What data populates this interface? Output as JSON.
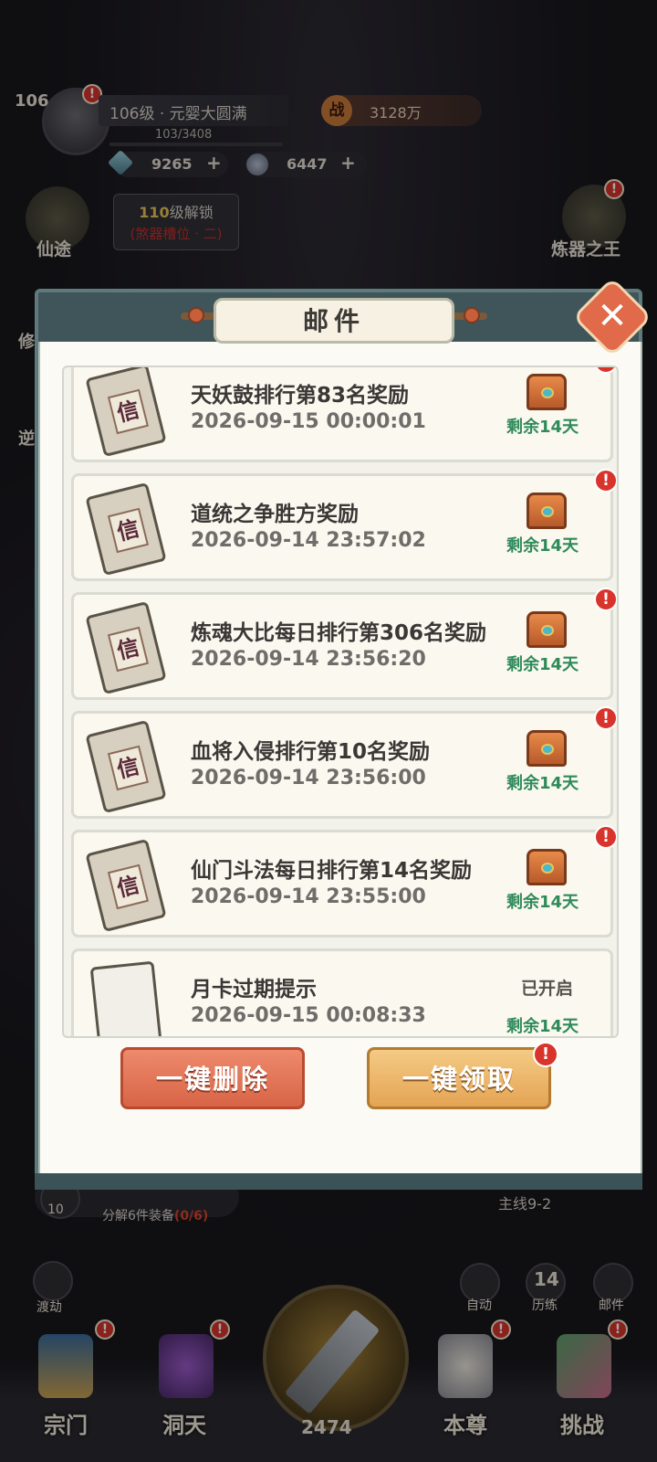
{
  "hud": {
    "player_level": "106",
    "player_title": "106级 · 元婴大圆满",
    "exp": "103/3408",
    "power_badge": "战",
    "power": "3128万",
    "gems": "9265",
    "coins": "6447",
    "plus": "+",
    "xiantu": "仙途",
    "lianqi": "炼器之王",
    "unlock_level": "110",
    "unlock_suffix": "级解锁",
    "unlock_desc": "(煞器槽位 · 二)",
    "left_peek_1": "修",
    "left_peek_2": "逆",
    "decompose_count": "10",
    "decompose_text": "分解6件装备",
    "decompose_progress": "(0/6)",
    "mainline": "主线9-2",
    "dujie": "渡劫",
    "auto": "自动",
    "lilian_count": "14",
    "lilian": "历练",
    "mail": "邮件",
    "orb_count": "2474",
    "nav": [
      "宗门",
      "洞天",
      "本尊",
      "挑战"
    ]
  },
  "modal": {
    "title": "邮件",
    "delete_all": "一键删除",
    "claim_all": "一键领取",
    "alert": "!",
    "stamp": "信"
  },
  "mails": [
    {
      "title": "天妖鼓排行第83名奖励",
      "date": "2026-09-15 00:00:01",
      "status": "",
      "remain": "剩余14天"
    },
    {
      "title": "道统之争胜方奖励",
      "date": "2026-09-14 23:57:02",
      "status": "",
      "remain": "剩余14天"
    },
    {
      "title": "炼魂大比每日排行第306名奖励",
      "date": "2026-09-14 23:56:20",
      "status": "",
      "remain": "剩余14天"
    },
    {
      "title": "血将入侵排行第10名奖励",
      "date": "2026-09-14 23:56:00",
      "status": "",
      "remain": "剩余14天"
    },
    {
      "title": "仙门斗法每日排行第14名奖励",
      "date": "2026-09-14 23:55:00",
      "status": "",
      "remain": "剩余14天"
    },
    {
      "title": "月卡过期提示",
      "date": "2026-09-15 00:08:33",
      "status": "已开启",
      "remain": "剩余14天"
    }
  ]
}
